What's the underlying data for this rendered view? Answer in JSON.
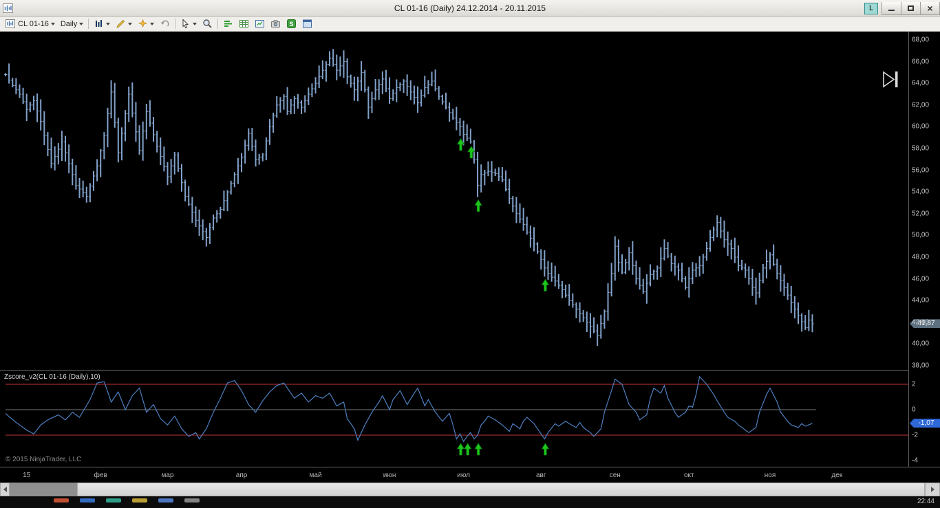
{
  "window": {
    "title": "CL 01-16 (Daily)  24.12.2014 - 20.11.2015",
    "link_button": "L"
  },
  "toolbar": {
    "instrument": "CL 01-16",
    "period": "Daily",
    "icons": [
      "instrument-chart",
      "chart-style",
      "drawing-tools",
      "draw-favorites",
      "undo",
      "cursor-tool",
      "zoom",
      "data-series",
      "data-grid",
      "chart-window",
      "snapshot",
      "strategy",
      "properties"
    ]
  },
  "chart": {
    "indicator_label": "Zscore_v2(CL 01-16 (Daily),10)",
    "copyright": "© 2015 NinjaTrader, LLC",
    "price_badge": "41,87",
    "price_badge_value": 41.87,
    "indicator_badge": "-1,07",
    "indicator_badge_value": -1.07
  },
  "colors": {
    "bars": "#82a1c9",
    "indicator_line": "#4d7fc0",
    "band_line": "#c43434",
    "zero_line": "#787878",
    "arrow_fill": "#1dc51d",
    "arrow_stroke": "#0b7d0b",
    "price_badge_bg": "#5c7080",
    "indicator_badge_bg": "#2e68d9"
  },
  "chart_data": [
    {
      "type": "ohlc-bar",
      "title": "CL 01-16 (Daily) 24.12.2014 - 20.11.2015",
      "ylim": [
        38,
        68
      ],
      "y_tick_labels": [
        "68,00",
        "66,00",
        "64,00",
        "62,00",
        "60,00",
        "58,00",
        "56,00",
        "54,00",
        "52,00",
        "50,00",
        "48,00",
        "46,00",
        "44,00",
        "42,00",
        "40,00",
        "38,00"
      ],
      "y_tick_values": [
        68,
        66,
        64,
        62,
        60,
        58,
        56,
        54,
        52,
        50,
        48,
        46,
        44,
        42,
        40,
        38
      ],
      "x_ticks": [
        {
          "label": "15",
          "bar": 6
        },
        {
          "label": "фев",
          "bar": 27
        },
        {
          "label": "мар",
          "bar": 46
        },
        {
          "label": "апр",
          "bar": 67
        },
        {
          "label": "май",
          "bar": 88
        },
        {
          "label": "июн",
          "bar": 109
        },
        {
          "label": "июл",
          "bar": 130
        },
        {
          "label": "авг",
          "bar": 152
        },
        {
          "label": "сен",
          "bar": 173
        },
        {
          "label": "окт",
          "bar": 194
        },
        {
          "label": "ноя",
          "bar": 217
        },
        {
          "label": "дек",
          "bar": 236
        }
      ],
      "bar_count": 230,
      "last_price": 41.87,
      "close_anchors": [
        [
          0,
          64.8
        ],
        [
          2,
          63.8
        ],
        [
          4,
          63.0
        ],
        [
          6,
          61.6
        ],
        [
          8,
          62.4
        ],
        [
          10,
          60.5
        ],
        [
          13,
          56.6
        ],
        [
          16,
          58.6
        ],
        [
          20,
          54.6
        ],
        [
          23,
          53.6
        ],
        [
          26,
          56.4
        ],
        [
          28,
          59.2
        ],
        [
          30,
          63.2
        ],
        [
          32,
          57.6
        ],
        [
          35,
          63.0
        ],
        [
          38,
          57.8
        ],
        [
          40,
          61.4
        ],
        [
          43,
          58.2
        ],
        [
          46,
          55.4
        ],
        [
          48,
          57.4
        ],
        [
          51,
          53.6
        ],
        [
          54,
          51.4
        ],
        [
          57,
          49.8
        ],
        [
          59,
          51.6
        ],
        [
          61,
          52.4
        ],
        [
          63,
          54.0
        ],
        [
          65,
          55.6
        ],
        [
          67,
          57.2
        ],
        [
          69,
          59.4
        ],
        [
          71,
          57.0
        ],
        [
          73,
          57.4
        ],
        [
          75,
          60.0
        ],
        [
          77,
          62.0
        ],
        [
          79,
          62.8
        ],
        [
          80,
          61.4
        ],
        [
          82,
          62.6
        ],
        [
          84,
          61.8
        ],
        [
          86,
          63.0
        ],
        [
          88,
          64.0
        ],
        [
          90,
          65.2
        ],
        [
          92,
          66.3
        ],
        [
          94,
          65.2
        ],
        [
          96,
          66.0
        ],
        [
          97,
          64.6
        ],
        [
          99,
          63.4
        ],
        [
          101,
          65.0
        ],
        [
          103,
          61.8
        ],
        [
          105,
          63.4
        ],
        [
          107,
          64.4
        ],
        [
          109,
          62.6
        ],
        [
          111,
          63.6
        ],
        [
          113,
          64.2
        ],
        [
          115,
          63.2
        ],
        [
          117,
          62.2
        ],
        [
          119,
          63.6
        ],
        [
          121,
          64.2
        ],
        [
          123,
          62.8
        ],
        [
          125,
          61.8
        ],
        [
          127,
          60.8
        ],
        [
          129,
          60.0
        ],
        [
          130,
          59.3
        ],
        [
          132,
          58.6
        ],
        [
          133,
          57.0
        ],
        [
          134,
          54.6
        ],
        [
          135,
          55.6
        ],
        [
          137,
          55.9
        ],
        [
          139,
          55.7
        ],
        [
          141,
          55.1
        ],
        [
          143,
          53.4
        ],
        [
          145,
          52.0
        ],
        [
          147,
          51.0
        ],
        [
          148,
          50.3
        ],
        [
          150,
          49.2
        ],
        [
          151,
          48.5
        ],
        [
          152,
          47.8
        ],
        [
          153,
          47.0
        ],
        [
          154,
          46.5
        ],
        [
          156,
          45.8
        ],
        [
          158,
          45.0
        ],
        [
          160,
          44.0
        ],
        [
          162,
          43.2
        ],
        [
          164,
          42.4
        ],
        [
          166,
          41.6
        ],
        [
          168,
          40.8
        ],
        [
          170,
          43.0
        ],
        [
          172,
          46.5
        ],
        [
          173,
          49.0
        ],
        [
          174,
          47.5
        ],
        [
          175,
          46.6
        ],
        [
          176,
          47.5
        ],
        [
          177,
          48.4
        ],
        [
          179,
          46.0
        ],
        [
          181,
          44.8
        ],
        [
          183,
          46.4
        ],
        [
          185,
          47.0
        ],
        [
          187,
          48.8
        ],
        [
          189,
          47.4
        ],
        [
          191,
          46.8
        ],
        [
          193,
          45.2
        ],
        [
          195,
          46.8
        ],
        [
          197,
          47.2
        ],
        [
          199,
          48.8
        ],
        [
          200,
          49.8
        ],
        [
          202,
          51.2
        ],
        [
          204,
          49.6
        ],
        [
          206,
          48.8
        ],
        [
          208,
          47.2
        ],
        [
          210,
          46.8
        ],
        [
          212,
          45.2
        ],
        [
          213,
          44.7
        ],
        [
          215,
          47.0
        ],
        [
          217,
          48.2
        ],
        [
          219,
          46.5
        ],
        [
          221,
          45.2
        ],
        [
          223,
          43.8
        ],
        [
          225,
          42.6
        ],
        [
          227,
          41.5
        ],
        [
          228,
          42.2
        ],
        [
          229,
          41.87
        ]
      ],
      "buy_arrows_bars": [
        129,
        132,
        134,
        153
      ]
    },
    {
      "type": "line",
      "title": "Zscore_v2(CL 01-16 (Daily),10)",
      "ylim": [
        -4.3,
        2.7
      ],
      "y_tick_labels": [
        "2",
        "0",
        "-2",
        "-4"
      ],
      "y_tick_values": [
        2,
        0,
        -2,
        -4
      ],
      "bands": {
        "upper": 2,
        "lower": -2,
        "zero": 0
      },
      "last_value": -1.07,
      "value_anchors": [
        [
          0,
          -0.3
        ],
        [
          3,
          -1.0
        ],
        [
          6,
          -1.6
        ],
        [
          8,
          -1.9
        ],
        [
          10,
          -1.2
        ],
        [
          12,
          -0.8
        ],
        [
          15,
          -0.4
        ],
        [
          17,
          -0.8
        ],
        [
          19,
          -0.2
        ],
        [
          21,
          -0.6
        ],
        [
          24,
          0.8
        ],
        [
          26,
          2.1
        ],
        [
          28,
          2.2
        ],
        [
          30,
          0.6
        ],
        [
          32,
          1.4
        ],
        [
          34,
          0.0
        ],
        [
          36,
          1.1
        ],
        [
          38,
          1.7
        ],
        [
          40,
          -0.2
        ],
        [
          42,
          0.4
        ],
        [
          44,
          -0.7
        ],
        [
          46,
          -1.2
        ],
        [
          48,
          -0.5
        ],
        [
          50,
          -1.5
        ],
        [
          52,
          -2.1
        ],
        [
          54,
          -1.8
        ],
        [
          55,
          -2.3
        ],
        [
          57,
          -1.5
        ],
        [
          59,
          -0.2
        ],
        [
          61,
          0.9
        ],
        [
          63,
          2.1
        ],
        [
          65,
          2.3
        ],
        [
          67,
          1.5
        ],
        [
          69,
          0.4
        ],
        [
          71,
          -0.2
        ],
        [
          73,
          0.7
        ],
        [
          75,
          1.4
        ],
        [
          77,
          1.9
        ],
        [
          79,
          2.1
        ],
        [
          80,
          1.7
        ],
        [
          82,
          0.9
        ],
        [
          84,
          1.3
        ],
        [
          86,
          0.6
        ],
        [
          88,
          1.1
        ],
        [
          90,
          0.9
        ],
        [
          92,
          1.3
        ],
        [
          94,
          0.3
        ],
        [
          96,
          0.6
        ],
        [
          97,
          -0.7
        ],
        [
          99,
          -1.5
        ],
        [
          100,
          -2.4
        ],
        [
          102,
          -1.2
        ],
        [
          104,
          -0.2
        ],
        [
          106,
          0.6
        ],
        [
          107,
          1.1
        ],
        [
          109,
          0.0
        ],
        [
          110,
          0.8
        ],
        [
          112,
          1.5
        ],
        [
          114,
          0.4
        ],
        [
          116,
          1.3
        ],
        [
          117,
          1.7
        ],
        [
          119,
          0.3
        ],
        [
          120,
          0.8
        ],
        [
          122,
          -0.2
        ],
        [
          124,
          -0.9
        ],
        [
          126,
          -0.3
        ],
        [
          127,
          -1.2
        ],
        [
          128,
          -2.3
        ],
        [
          129,
          -1.9
        ],
        [
          130,
          -2.5
        ],
        [
          131,
          -2.1
        ],
        [
          132,
          -1.8
        ],
        [
          133,
          -2.3
        ],
        [
          134,
          -2.0
        ],
        [
          135,
          -1.2
        ],
        [
          136,
          -0.9
        ],
        [
          137,
          -0.5
        ],
        [
          139,
          -0.8
        ],
        [
          141,
          -1.2
        ],
        [
          143,
          -1.7
        ],
        [
          144,
          -1.1
        ],
        [
          146,
          -1.5
        ],
        [
          147,
          -0.9
        ],
        [
          148,
          -0.6
        ],
        [
          150,
          -1.1
        ],
        [
          151,
          -1.5
        ],
        [
          153,
          -2.3
        ],
        [
          154,
          -1.8
        ],
        [
          156,
          -1.1
        ],
        [
          157,
          -1.3
        ],
        [
          159,
          -0.9
        ],
        [
          160,
          -1.1
        ],
        [
          162,
          -1.4
        ],
        [
          163,
          -1.0
        ],
        [
          164,
          -1.4
        ],
        [
          166,
          -1.8
        ],
        [
          167,
          -2.1
        ],
        [
          169,
          -1.5
        ],
        [
          170,
          -0.2
        ],
        [
          172,
          1.5
        ],
        [
          173,
          2.4
        ],
        [
          175,
          2.0
        ],
        [
          176,
          1.2
        ],
        [
          177,
          0.4
        ],
        [
          179,
          -0.2
        ],
        [
          180,
          -0.8
        ],
        [
          182,
          -0.4
        ],
        [
          183,
          0.9
        ],
        [
          184,
          1.7
        ],
        [
          186,
          1.3
        ],
        [
          187,
          1.9
        ],
        [
          188,
          0.9
        ],
        [
          190,
          -0.2
        ],
        [
          191,
          -0.6
        ],
        [
          193,
          -0.2
        ],
        [
          194,
          0.3
        ],
        [
          195,
          0.2
        ],
        [
          196,
          1.2
        ],
        [
          197,
          2.6
        ],
        [
          198,
          2.3
        ],
        [
          199,
          2.0
        ],
        [
          201,
          1.2
        ],
        [
          202,
          0.7
        ],
        [
          204,
          -0.2
        ],
        [
          205,
          -0.6
        ],
        [
          207,
          -0.9
        ],
        [
          208,
          -1.2
        ],
        [
          210,
          -1.6
        ],
        [
          211,
          -1.8
        ],
        [
          213,
          -1.4
        ],
        [
          214,
          -0.2
        ],
        [
          216,
          1.2
        ],
        [
          217,
          1.7
        ],
        [
          219,
          0.6
        ],
        [
          220,
          -0.2
        ],
        [
          222,
          -0.9
        ],
        [
          223,
          -1.2
        ],
        [
          225,
          -1.4
        ],
        [
          226,
          -1.1
        ],
        [
          227,
          -1.3
        ],
        [
          229,
          -1.07
        ]
      ],
      "arrows_bars": [
        129,
        131,
        134,
        153
      ]
    }
  ],
  "taskbar": {
    "clock": "22:44",
    "icon_colors": [
      "#e05a3a",
      "#3a7de0",
      "#35b8a0",
      "#d8b93c",
      "#5a8adf",
      "#9a9a9a"
    ]
  }
}
